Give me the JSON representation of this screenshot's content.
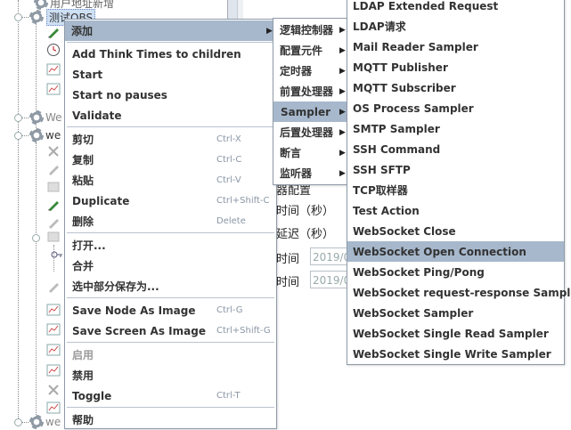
{
  "tree": {
    "top_partial_label": "用户地址新增",
    "selected_node": "测试OBS",
    "partial_node_1": "We",
    "partial_node_2": "we",
    "partial_node_3": "we"
  },
  "form": {
    "labels": [
      "器配置",
      "时间（秒）",
      "延迟（秒）",
      "时间",
      "时间"
    ],
    "field_values": [
      "2019/0",
      "2019/0"
    ]
  },
  "context_menu": {
    "items": [
      {
        "label": "添加",
        "accel": "",
        "submenu": true,
        "highlighted": true
      },
      {
        "label": "Add Think Times to children",
        "accel": ""
      },
      {
        "label": "Start",
        "accel": ""
      },
      {
        "label": "Start no pauses",
        "accel": ""
      },
      {
        "label": "Validate",
        "accel": ""
      },
      {
        "label": "剪切",
        "accel": "Ctrl-X"
      },
      {
        "label": "复制",
        "accel": "Ctrl-C"
      },
      {
        "label": "粘贴",
        "accel": "Ctrl-V"
      },
      {
        "label": "Duplicate",
        "accel": "Ctrl+Shift-C"
      },
      {
        "label": "删除",
        "accel": "Delete"
      },
      {
        "label": "打开...",
        "accel": ""
      },
      {
        "label": "合并",
        "accel": ""
      },
      {
        "label": "选中部分保存为...",
        "accel": ""
      },
      {
        "label": "Save Node As Image",
        "accel": "Ctrl-G"
      },
      {
        "label": "Save Screen As Image",
        "accel": "Ctrl+Shift-G"
      },
      {
        "label": "启用",
        "accel": "",
        "disabled": true
      },
      {
        "label": "禁用",
        "accel": ""
      },
      {
        "label": "Toggle",
        "accel": "Ctrl-T"
      },
      {
        "label": "帮助",
        "accel": ""
      }
    ]
  },
  "add_submenu": {
    "items": [
      {
        "label": "逻辑控制器"
      },
      {
        "label": "配置元件"
      },
      {
        "label": "定时器"
      },
      {
        "label": "前置处理器"
      },
      {
        "label": "Sampler",
        "highlighted": true
      },
      {
        "label": "后置处理器"
      },
      {
        "label": "断言"
      },
      {
        "label": "监听器"
      }
    ]
  },
  "sampler_submenu": {
    "items": [
      {
        "label": "LDAP Extended Request"
      },
      {
        "label": "LDAP请求"
      },
      {
        "label": "Mail Reader Sampler"
      },
      {
        "label": "MQTT Publisher"
      },
      {
        "label": "MQTT Subscriber"
      },
      {
        "label": "OS Process Sampler"
      },
      {
        "label": "SMTP Sampler"
      },
      {
        "label": "SSH Command"
      },
      {
        "label": "SSH SFTP"
      },
      {
        "label": "TCP取样器"
      },
      {
        "label": "Test Action"
      },
      {
        "label": "WebSocket Close"
      },
      {
        "label": "WebSocket Open Connection",
        "highlighted": true
      },
      {
        "label": "WebSocket Ping/Pong"
      },
      {
        "label": "WebSocket request-response Sampler"
      },
      {
        "label": "WebSocket Sampler"
      },
      {
        "label": "WebSocket Single Read Sampler"
      },
      {
        "label": "WebSocket Single Write Sampler"
      }
    ]
  },
  "colors": {
    "highlight": "#a7b8cc",
    "menu_border": "#8e9aa8",
    "accelerator": "#8a96a6"
  }
}
